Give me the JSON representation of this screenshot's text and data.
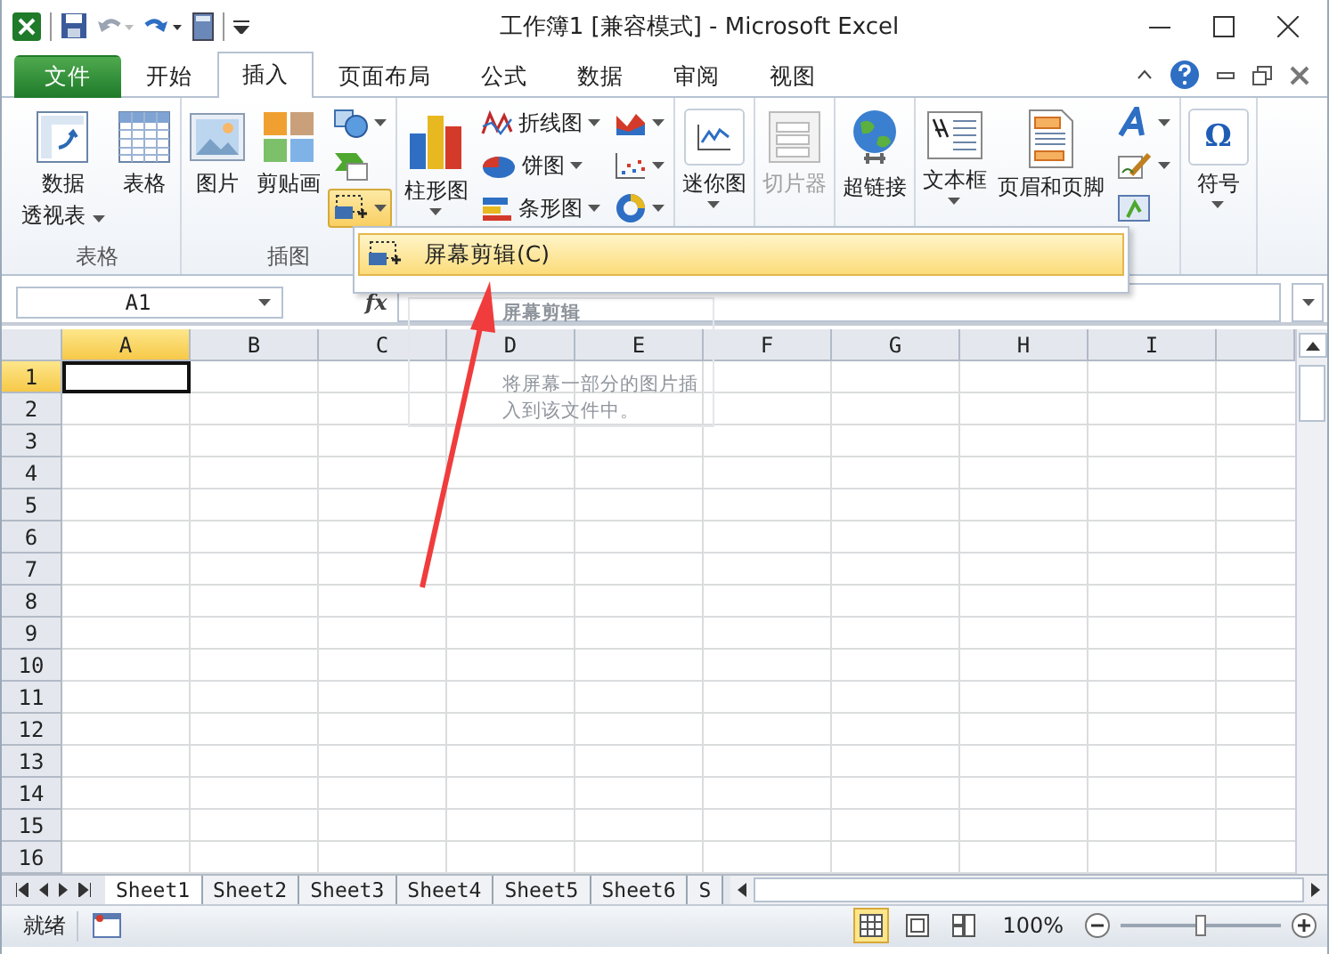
{
  "window": {
    "title": "工作簿1  [兼容模式] - Microsoft Excel"
  },
  "tabs": [
    {
      "label": "文件",
      "kind": "file",
      "selected": false
    },
    {
      "label": "开始",
      "kind": "tab",
      "selected": false
    },
    {
      "label": "插入",
      "kind": "tab",
      "selected": true
    },
    {
      "label": "页面布局",
      "kind": "tab",
      "selected": false
    },
    {
      "label": "公式",
      "kind": "tab",
      "selected": false
    },
    {
      "label": "数据",
      "kind": "tab",
      "selected": false
    },
    {
      "label": "审阅",
      "kind": "tab",
      "selected": false
    },
    {
      "label": "视图",
      "kind": "tab",
      "selected": false
    }
  ],
  "ribbon": {
    "groups": [
      {
        "label": "表格",
        "items": [
          {
            "kind": "large",
            "lines": [
              "数据",
              "透视表"
            ],
            "dropdown": true,
            "disabled": false
          },
          {
            "kind": "large",
            "lines": [
              "表格"
            ],
            "dropdown": false,
            "disabled": false
          }
        ]
      },
      {
        "label": "插图",
        "items": [
          {
            "kind": "large",
            "lines": [
              "图片"
            ],
            "dropdown": false,
            "disabled": false
          },
          {
            "kind": "large",
            "lines": [
              "剪贴画"
            ],
            "dropdown": false,
            "disabled": false
          },
          {
            "kind": "small",
            "dropdown": true,
            "open": false
          },
          {
            "kind": "small",
            "dropdown": false,
            "open": false
          },
          {
            "kind": "small",
            "dropdown": true,
            "open": true
          }
        ]
      },
      {
        "items": [
          {
            "kind": "large",
            "lines": [
              "柱形图"
            ],
            "dropdown": true,
            "disabled": false
          },
          {
            "kind": "small",
            "label": "折线图",
            "dropdown": true,
            "open": false
          },
          {
            "kind": "small",
            "label": "饼图",
            "dropdown": true,
            "open": false
          },
          {
            "kind": "small",
            "label": "条形图",
            "dropdown": true,
            "open": false
          },
          {
            "kind": "small",
            "dropdown": true,
            "open": false
          },
          {
            "kind": "small",
            "dropdown": true,
            "open": false
          },
          {
            "kind": "small",
            "dropdown": true,
            "open": false
          }
        ]
      },
      {
        "items": [
          {
            "kind": "boxed",
            "lines": [
              "迷你图"
            ],
            "dropdown": true,
            "disabled": false
          }
        ]
      },
      {
        "items": [
          {
            "kind": "large",
            "lines": [
              "切片器"
            ],
            "dropdown": false,
            "disabled": true
          }
        ]
      },
      {
        "items": [
          {
            "kind": "large",
            "lines": [
              "超链接"
            ],
            "dropdown": false,
            "disabled": false
          }
        ]
      },
      {
        "items": [
          {
            "kind": "large",
            "lines": [
              "文本框"
            ],
            "dropdown": true,
            "disabled": false
          },
          {
            "kind": "large",
            "lines": [
              "页眉和页脚"
            ],
            "dropdown": false,
            "disabled": false
          },
          {
            "kind": "small",
            "dropdown": true,
            "open": false
          },
          {
            "kind": "small",
            "dropdown": true,
            "open": false
          },
          {
            "kind": "small",
            "dropdown": false,
            "open": false
          }
        ]
      },
      {
        "items": [
          {
            "kind": "boxed",
            "glyph": "Ω",
            "lines": [
              "符号"
            ],
            "dropdown": true,
            "disabled": false
          }
        ]
      }
    ]
  },
  "dropdown_menu": {
    "items": [
      {
        "label": "屏幕剪辑(C)",
        "selected": true
      }
    ]
  },
  "tooltip": {
    "title": "屏幕剪辑",
    "text": "将屏幕一部分的图片插入到该文件中。"
  },
  "formula_bar": {
    "name_box": "A1",
    "function_label": "fx"
  },
  "sheet": {
    "columns": [
      {
        "label": "A",
        "selected": true
      },
      {
        "label": "B",
        "selected": false
      },
      {
        "label": "C",
        "selected": false
      },
      {
        "label": "D",
        "selected": false
      },
      {
        "label": "E",
        "selected": false
      },
      {
        "label": "F",
        "selected": false
      },
      {
        "label": "G",
        "selected": false
      },
      {
        "label": "H",
        "selected": false
      },
      {
        "label": "I",
        "selected": false
      }
    ],
    "rows": [
      {
        "label": "1",
        "selected": true
      },
      {
        "label": "2",
        "selected": false
      },
      {
        "label": "3",
        "selected": false
      },
      {
        "label": "4",
        "selected": false
      },
      {
        "label": "5",
        "selected": false
      },
      {
        "label": "6",
        "selected": false
      },
      {
        "label": "7",
        "selected": false
      },
      {
        "label": "8",
        "selected": false
      },
      {
        "label": "9",
        "selected": false
      },
      {
        "label": "10",
        "selected": false
      },
      {
        "label": "11",
        "selected": false
      },
      {
        "label": "12",
        "selected": false
      },
      {
        "label": "13",
        "selected": false
      },
      {
        "label": "14",
        "selected": false
      },
      {
        "label": "15",
        "selected": false
      },
      {
        "label": "16",
        "selected": false
      }
    ]
  },
  "sheet_tabs": [
    {
      "label": "Sheet1",
      "selected": true
    },
    {
      "label": "Sheet2",
      "selected": false
    },
    {
      "label": "Sheet3",
      "selected": false
    },
    {
      "label": "Sheet4",
      "selected": false
    },
    {
      "label": "Sheet5",
      "selected": false
    },
    {
      "label": "Sheet6",
      "selected": false
    },
    {
      "label": "S",
      "selected": false
    }
  ],
  "status_bar": {
    "status": "就绪",
    "views": [
      {
        "kind": "normal",
        "selected": true
      },
      {
        "kind": "layout",
        "selected": false
      },
      {
        "kind": "pagebreak",
        "selected": false
      }
    ],
    "zoom": "100%",
    "level": 0.5
  }
}
